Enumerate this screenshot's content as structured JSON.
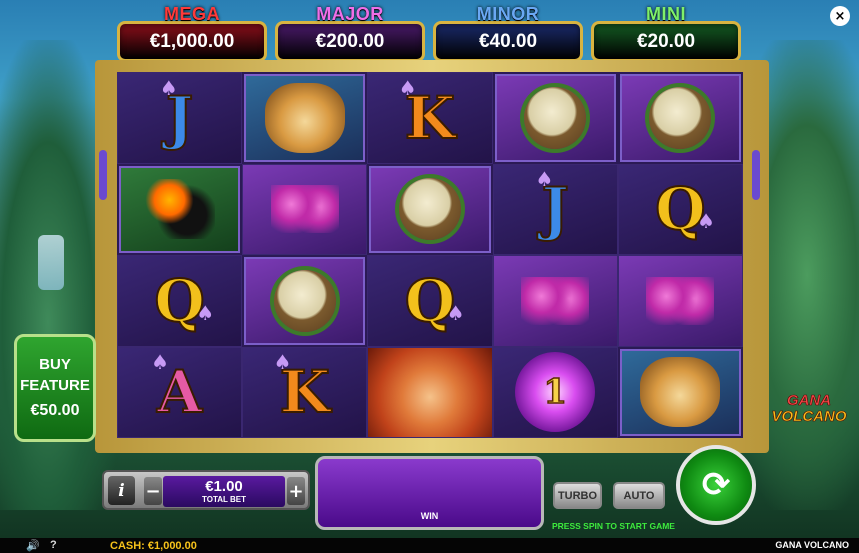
{
  "jackpots": [
    {
      "name": "MEGA",
      "value": "€1,000.00",
      "name_color": "#ff3a3a",
      "box_color": "#8a0f1a"
    },
    {
      "name": "MAJOR",
      "value": "€200.00",
      "name_color": "#f06ee8",
      "box_color": "#4a1a6a"
    },
    {
      "name": "MINOR",
      "value": "€40.00",
      "name_color": "#6aa8f4",
      "box_color": "#1a2a6a"
    },
    {
      "name": "MINI",
      "value": "€20.00",
      "name_color": "#7ef06a",
      "box_color": "#145a22"
    }
  ],
  "reels": [
    [
      "J",
      "leopard",
      "K",
      "drum",
      "drum"
    ],
    [
      "toucan",
      "orchid",
      "drum",
      "J",
      "Q"
    ],
    [
      "Q",
      "drum",
      "Q",
      "orchid",
      "orchid"
    ],
    [
      "A",
      "K",
      "goddess",
      "orb",
      "leopard"
    ]
  ],
  "orb_value": "1",
  "buy_feature": {
    "line1": "BUY",
    "line2": "FEATURE",
    "price": "€50.00"
  },
  "logo": {
    "line1": "GANA",
    "line2": "VOLCANO"
  },
  "controls": {
    "info": "i",
    "minus": "−",
    "plus": "+",
    "bet_value": "€1.00",
    "bet_label": "TOTAL BET",
    "win_label": "WIN",
    "turbo": "TURBO",
    "auto": "AUTO",
    "press_spin": "PRESS SPIN TO START GAME"
  },
  "footer": {
    "sound_icon": "speaker-icon",
    "help_label": "?",
    "cash_label": "CASH:",
    "cash_value": "€1,000.00",
    "game_name": "GANA VOLCANO"
  },
  "close_label": "×"
}
